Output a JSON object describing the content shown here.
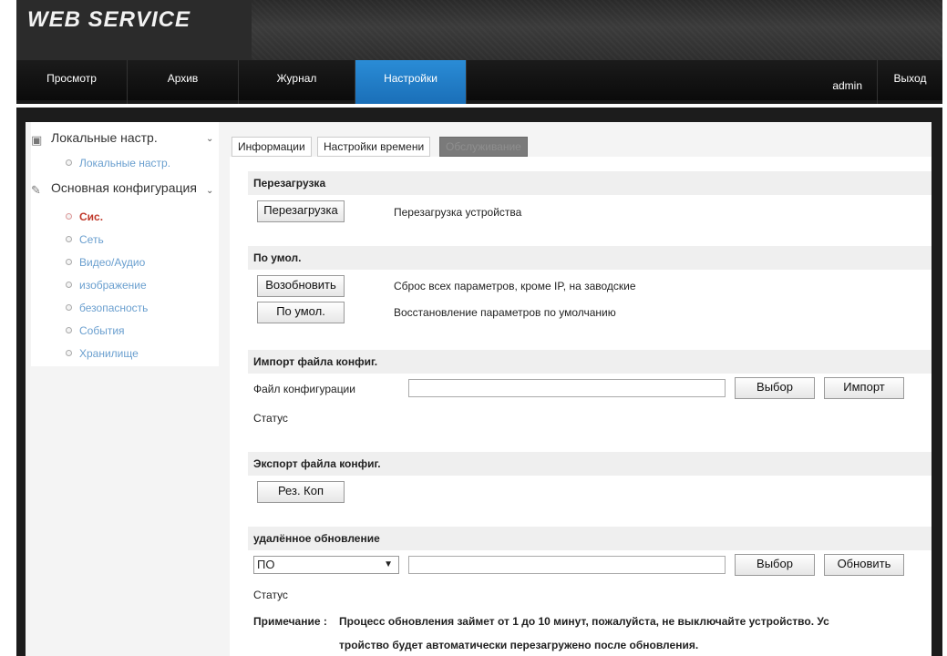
{
  "app": {
    "title": "WEB SERVICE"
  },
  "nav": {
    "items": [
      "Просмотр",
      "Архив",
      "Журнал",
      "Настройки"
    ],
    "user": "admin",
    "logout": "Выход"
  },
  "sidebar": {
    "groups": [
      {
        "label": "Локальные настр.",
        "icon": "monitor-icon",
        "items": [
          "Локальные настр."
        ]
      },
      {
        "label": "Основная конфигурация",
        "icon": "wrench-icon",
        "items": [
          "Сис.",
          "Сеть",
          "Видео/Аудио",
          "изображение",
          "безопасность",
          "События",
          "Хранилище"
        ]
      }
    ],
    "active_item": "Сис."
  },
  "tabs": [
    "Информации",
    "Настройки времени",
    "Обслуживание"
  ],
  "sections": {
    "reboot": {
      "title": "Перезагрузка",
      "button": "Перезагрузка",
      "desc": "Перезагрузка устройства"
    },
    "default": {
      "title": "По умол.",
      "restore_button": "Возобновить",
      "restore_desc": "Сброс всех параметров, кроме IP, на заводские",
      "default_button": "По умол.",
      "default_desc": "Восстановление параметров по умолчанию"
    },
    "import": {
      "title": "Импорт файла конфиг.",
      "file_label": "Файл конфигурации",
      "file_value": "",
      "browse_button": "Выбор",
      "import_button": "Импорт",
      "status_label": "Статус"
    },
    "export": {
      "title": "Экспорт файла конфиг.",
      "backup_button": "Рез. Коп"
    },
    "upgrade": {
      "title": "удалённое обновление",
      "type_selected": "ПО",
      "file_value": "",
      "browse_button": "Выбор",
      "upgrade_button": "Обновить",
      "status_label": "Статус",
      "note_label": "Примечание :",
      "note_line1": "Процесс обновления займет от 1 до 10 минут, пожалуйста, не выключайте устройство. Ус",
      "note_line2": "тройство будет автоматически перезагружено после обновления."
    }
  },
  "colors": {
    "active_tab": "#1a6fb8",
    "sidebar_link": "#6a9fcf",
    "sidebar_active": "#c0392b"
  }
}
